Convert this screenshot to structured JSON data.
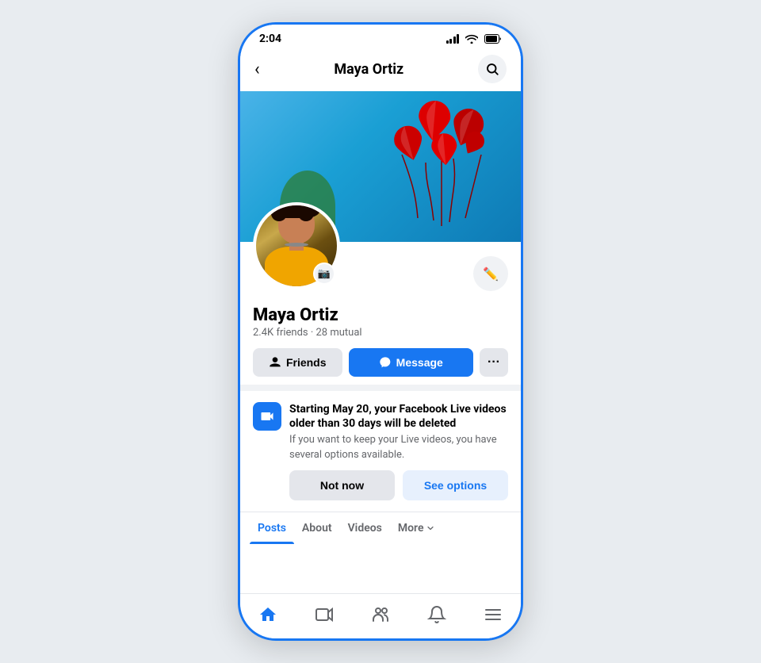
{
  "status_bar": {
    "time": "2:04",
    "signal_icon": "signal",
    "wifi_icon": "wifi",
    "battery_icon": "battery"
  },
  "top_nav": {
    "back_label": "‹",
    "title": "Maya Ortiz",
    "search_icon": "search"
  },
  "profile": {
    "name": "Maya Ortiz",
    "friends_count": "2.4K",
    "friends_label": "friends",
    "mutual_count": "28",
    "mutual_label": "mutual"
  },
  "action_buttons": {
    "friends_label": "Friends",
    "message_label": "Message",
    "more_label": "···"
  },
  "notification_banner": {
    "title": "Starting May 20, your Facebook Live videos older than 30 days will be deleted",
    "subtitle": "If you want to keep your Live videos, you have several options available.",
    "not_now_label": "Not now",
    "see_options_label": "See options"
  },
  "tabs": {
    "posts_label": "Posts",
    "about_label": "About",
    "videos_label": "Videos",
    "more_label": "More"
  },
  "bottom_nav": {
    "home_icon": "home",
    "video_icon": "video",
    "friends_icon": "friends",
    "bell_icon": "bell",
    "menu_icon": "menu"
  }
}
